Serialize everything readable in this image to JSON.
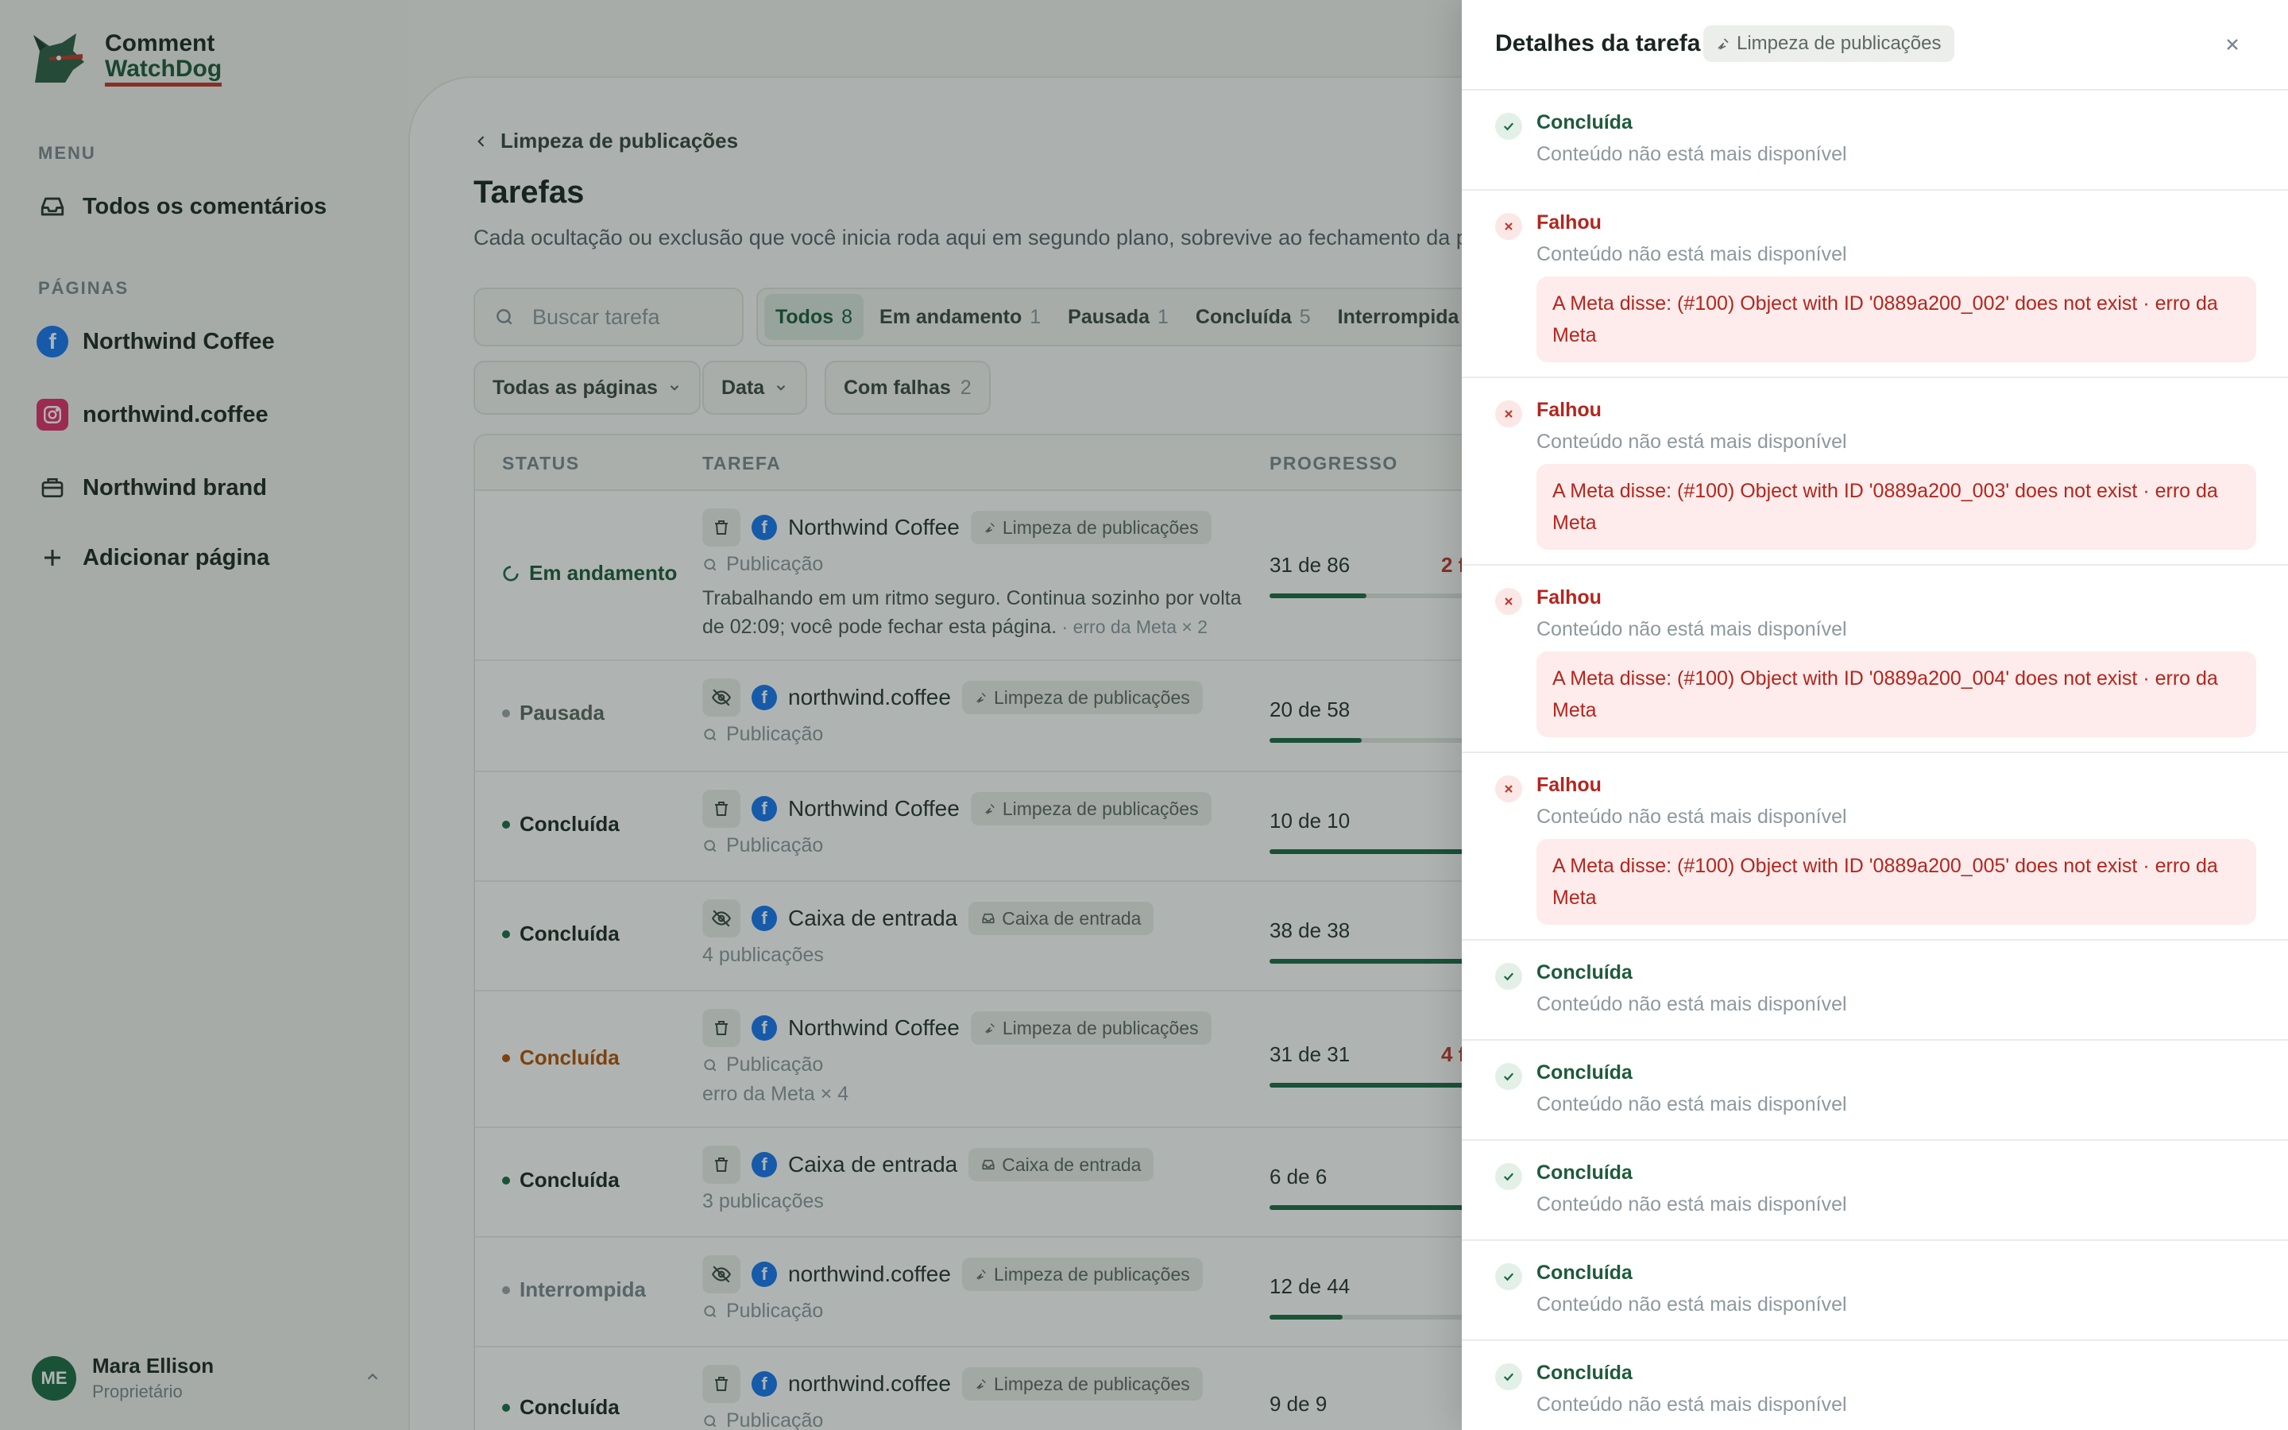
{
  "brand": {
    "line1": "Comment",
    "line2": "WatchDog"
  },
  "sidebar": {
    "menu_label": "MENU",
    "all_comments": "Todos os comentários",
    "pages_label": "PÁGINAS",
    "pages": [
      {
        "label": "Northwind Coffee",
        "icon": "facebook-icon"
      },
      {
        "label": "northwind.coffee",
        "icon": "instagram-icon"
      },
      {
        "label": "Northwind brand",
        "icon": "briefcase-icon"
      }
    ],
    "add_page": "Adicionar página"
  },
  "user": {
    "initials": "ME",
    "name": "Mara Ellison",
    "role": "Proprietário"
  },
  "main": {
    "breadcrumb": "Limpeza de publicações",
    "title": "Tarefas",
    "subtitle": "Cada ocultação ou exclusão que você inicia roda aqui em segundo plano, sobrevive ao fechamento da p",
    "search_placeholder": "Buscar tarefa",
    "tabs": [
      {
        "label": "Todos",
        "count": "8"
      },
      {
        "label": "Em andamento",
        "count": "1"
      },
      {
        "label": "Pausada",
        "count": "1"
      },
      {
        "label": "Concluída",
        "count": "5"
      },
      {
        "label": "Interrompida",
        "count": "1"
      }
    ],
    "filters": {
      "pages": "Todas as páginas",
      "date": "Data",
      "failed": "Com falhas",
      "failed_count": "2"
    },
    "columns": {
      "status": "STATUS",
      "task": "TAREFA",
      "progress": "PROGRESSO"
    }
  },
  "rows": [
    {
      "status": "Em andamento",
      "page": "Northwind Coffee",
      "chip": "Limpeza de publicações",
      "sub": "Publicação",
      "note": "Trabalhando em um ritmo seguro. Continua sozinho por volta de 02:09; você pode fechar esta página.",
      "note_muted": " · erro da Meta × 2",
      "progress": "31 de 86",
      "progress_value": 0.36,
      "fail": "2 f"
    },
    {
      "status": "Pausada",
      "page": "northwind.coffee",
      "chip": "Limpeza de publicações",
      "sub": "Publicação",
      "progress": "20 de 58",
      "progress_value": 0.34
    },
    {
      "status": "Concluída",
      "page": "Northwind Coffee",
      "chip": "Limpeza de publicações",
      "sub": "Publicação",
      "progress": "10 de 10",
      "progress_value": 1
    },
    {
      "status": "Concluída",
      "page": "Caixa de entrada",
      "chip": "Caixa de entrada",
      "sub": "4 publicações",
      "progress": "38 de 38",
      "progress_value": 1
    },
    {
      "status": "Concluída",
      "page": "Northwind Coffee",
      "chip": "Limpeza de publicações",
      "sub": "Publicação",
      "extra": "erro da Meta × 4",
      "progress": "31 de 31",
      "progress_value": 1,
      "fail": "4 f"
    },
    {
      "status": "Concluída",
      "page": "Caixa de entrada",
      "chip": "Caixa de entrada",
      "sub": "3 publicações",
      "progress": "6 de 6",
      "progress_value": 1
    },
    {
      "status": "Interrompida",
      "page": "northwind.coffee",
      "chip": "Limpeza de publicações",
      "sub": "Publicação",
      "progress": "12 de 44",
      "progress_value": 0.27
    },
    {
      "status": "Concluída",
      "page": "northwind.coffee",
      "chip": "Limpeza de publicações",
      "sub": "Publicação",
      "progress": "9 de 9",
      "progress_value": 1
    }
  ],
  "panel": {
    "title": "Detalhes da tarefa",
    "chip": "Limpeza de publicações",
    "items": [
      {
        "title": "Concluída",
        "desc": "Conteúdo não está mais disponível"
      },
      {
        "title": "Falhou",
        "desc": "Conteúdo não está mais disponível",
        "error": "A Meta disse: (#100) Object with ID '0889a200_002' does not exist · erro da Meta"
      },
      {
        "title": "Falhou",
        "desc": "Conteúdo não está mais disponível",
        "error": "A Meta disse: (#100) Object with ID '0889a200_003' does not exist · erro da Meta"
      },
      {
        "title": "Falhou",
        "desc": "Conteúdo não está mais disponível",
        "error": "A Meta disse: (#100) Object with ID '0889a200_004' does not exist · erro da Meta"
      },
      {
        "title": "Falhou",
        "desc": "Conteúdo não está mais disponível",
        "error": "A Meta disse: (#100) Object with ID '0889a200_005' does not exist · erro da Meta"
      },
      {
        "title": "Concluída",
        "desc": "Conteúdo não está mais disponível"
      },
      {
        "title": "Concluída",
        "desc": "Conteúdo não está mais disponível"
      },
      {
        "title": "Concluída",
        "desc": "Conteúdo não está mais disponível"
      },
      {
        "title": "Concluída",
        "desc": "Conteúdo não está mais disponível"
      },
      {
        "title": "Concluída",
        "desc": "Conteúdo não está mais disponível"
      }
    ]
  },
  "colors": {
    "accent": "#1e5a3c",
    "error": "#b3261e",
    "facebook": "#1877f2",
    "instagram": "#e1306c",
    "warning": "#b45309"
  }
}
